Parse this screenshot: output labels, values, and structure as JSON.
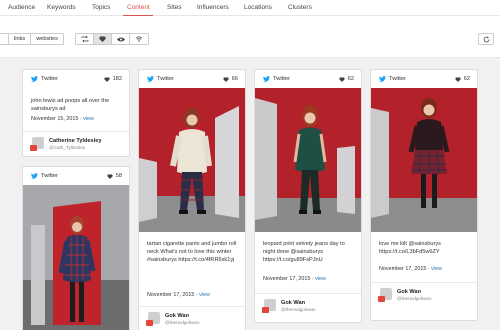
{
  "nav": {
    "items": [
      {
        "label": "Audience"
      },
      {
        "label": "Keywords"
      },
      {
        "label": "Topics"
      },
      {
        "label": "Content",
        "active": true
      },
      {
        "label": "Sites"
      },
      {
        "label": "Influencers"
      },
      {
        "label": "Locations"
      },
      {
        "label": "Clusters"
      }
    ],
    "accent_color": "#d9534f"
  },
  "toolbar": {
    "type_filter": {
      "options": [
        "links",
        "websites"
      ]
    },
    "action_icons": [
      "retweet-icon",
      "heart-icon",
      "eye-icon",
      "signal-icon"
    ],
    "active_icon": "heart-icon",
    "refresh_icon": "refresh-icon"
  },
  "posts": [
    {
      "source": "Twitter",
      "likes": "182",
      "text": "john lewis ad poops all over the sainsburys ad",
      "date": "November 15, 2015",
      "view": "view",
      "author_name": "Catherine Tyldesley",
      "author_handle": "@Cath_Tyldesley"
    },
    {
      "source": "Twitter",
      "likes": "66",
      "text": "tartan cigarette pants and jumbo roll neck What's not to love this winter #sainsburys https://t.co/4fRR6xk1yj",
      "date": "November 17, 2015",
      "view": "view",
      "author_name": "Gok Wan",
      "author_handle": "@therealgokwan"
    },
    {
      "source": "Twitter",
      "likes": "62",
      "text": "leopard print velvety jeans day to night done @sainsburys https://t.co/gu89FsPJnU",
      "date": "November 17, 2015",
      "view": "view",
      "author_name": "Gok Wan",
      "author_handle": "@therealgokwan"
    },
    {
      "source": "Twitter",
      "likes": "62",
      "text": "love me kilt @sainsburys https://t.co/L3bFd5w6ZY",
      "date": "November 17, 2015",
      "view": "view",
      "author_name": "Gok Wan",
      "author_handle": "@therealgokwan"
    },
    {
      "source": "Twitter",
      "likes": "58"
    }
  ],
  "colors": {
    "twitter": "#1da1f2",
    "link": "#2a7ab9",
    "backdrop_red": "#b3222b",
    "badge": "#e2453b"
  }
}
